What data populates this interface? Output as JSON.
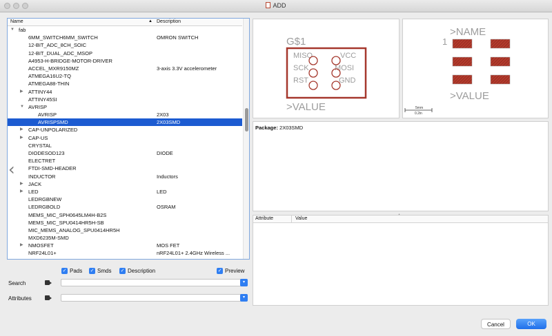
{
  "window": {
    "title": "ADD"
  },
  "tree": {
    "columns": {
      "name": "Name",
      "description": "Description"
    },
    "rows": [
      {
        "name": "fab",
        "desc": "",
        "level": 0,
        "arrow": "open"
      },
      {
        "name": "6MM_SWITCH6MM_SWITCH",
        "desc": "OMRON SWITCH",
        "level": 1,
        "arrow": ""
      },
      {
        "name": "12-BIT_ADC_8CH_SOIC",
        "desc": "",
        "level": 1,
        "arrow": ""
      },
      {
        "name": "12-BIT_DUAL_ADC_MSOP",
        "desc": "",
        "level": 1,
        "arrow": ""
      },
      {
        "name": "A4953-H-BRIDGE-MOTOR-DRIVER",
        "desc": "",
        "level": 1,
        "arrow": ""
      },
      {
        "name": "ACCEL_MXR9150MZ",
        "desc": "3-axis 3.3V accelerometer",
        "level": 1,
        "arrow": ""
      },
      {
        "name": "ATMEGA16U2-TQ",
        "desc": "",
        "level": 1,
        "arrow": ""
      },
      {
        "name": "ATMEGA88-THIN",
        "desc": "",
        "level": 1,
        "arrow": ""
      },
      {
        "name": "ATTINY44",
        "desc": "",
        "level": 1,
        "arrow": "closed"
      },
      {
        "name": "ATTINY45SI",
        "desc": "",
        "level": 1,
        "arrow": ""
      },
      {
        "name": "AVRISP",
        "desc": "",
        "level": 1,
        "arrow": "open"
      },
      {
        "name": "AVRISP",
        "desc": "2X03",
        "level": 2,
        "arrow": ""
      },
      {
        "name": "AVRISPSMD",
        "desc": "2X03SMD",
        "level": 2,
        "arrow": "",
        "selected": true
      },
      {
        "name": "CAP-UNPOLARIZED",
        "desc": "",
        "level": 1,
        "arrow": "closed"
      },
      {
        "name": "CAP-US",
        "desc": "",
        "level": 1,
        "arrow": "closed"
      },
      {
        "name": "CRYSTAL",
        "desc": "",
        "level": 1,
        "arrow": ""
      },
      {
        "name": "DIODESOD123",
        "desc": "DIODE",
        "level": 1,
        "arrow": ""
      },
      {
        "name": "ELECTRET",
        "desc": "",
        "level": 1,
        "arrow": ""
      },
      {
        "name": "FTDI-SMD-HEADER",
        "desc": "",
        "level": 1,
        "arrow": ""
      },
      {
        "name": "INDUCTOR",
        "desc": "Inductors",
        "level": 1,
        "arrow": ""
      },
      {
        "name": "JACK",
        "desc": "",
        "level": 1,
        "arrow": "closed"
      },
      {
        "name": "LED",
        "desc": "LED",
        "level": 1,
        "arrow": "closed"
      },
      {
        "name": "LEDRGBNEW",
        "desc": "",
        "level": 1,
        "arrow": ""
      },
      {
        "name": "LEDRGBOLD",
        "desc": "OSRAM",
        "level": 1,
        "arrow": ""
      },
      {
        "name": "MEMS_MIC_SPH0645LM4H-B2S",
        "desc": "",
        "level": 1,
        "arrow": ""
      },
      {
        "name": "MEMS_MIC_SPU0414HR5H-SB",
        "desc": "",
        "level": 1,
        "arrow": ""
      },
      {
        "name": "MIC_MEMS_ANALOG_SPU0414HR5H",
        "desc": "",
        "level": 1,
        "arrow": ""
      },
      {
        "name": "MXD6235M-SMD",
        "desc": "",
        "level": 1,
        "arrow": ""
      },
      {
        "name": "NMOSFET",
        "desc": "MOS FET",
        "level": 1,
        "arrow": "closed"
      },
      {
        "name": "NRF24L01+",
        "desc": "nRF24L01+ 2.4GHz Wireless ...",
        "level": 1,
        "arrow": ""
      }
    ]
  },
  "filters": {
    "pads": "Pads",
    "smds": "Smds",
    "description": "Description",
    "preview": "Preview"
  },
  "search": {
    "label": "Search",
    "value": "",
    "placeholder": ""
  },
  "attributes": {
    "label": "Attributes",
    "value": "",
    "placeholder": ""
  },
  "symbol": {
    "name_label": "G$1",
    "value_label": ">VALUE",
    "pins_left": [
      "MISO",
      "SCK",
      "RST"
    ],
    "pins_right": [
      "VCC",
      "MOSI",
      "GND"
    ]
  },
  "footprint": {
    "name_label": ">NAME",
    "value_label": ">VALUE",
    "pin1": "1",
    "scale_top": "5mm",
    "scale_bottom": "0.2in"
  },
  "package": {
    "label": "Package:",
    "value": "2X03SMD"
  },
  "attr_table": {
    "col_attribute": "Attribute",
    "col_value": "Value"
  },
  "buttons": {
    "cancel": "Cancel",
    "ok": "OK"
  },
  "colors": {
    "accent": "#2f7ef2",
    "selection": "#1c5bd1",
    "schematic_red": "#a5372c",
    "schematic_grey": "#9c9c9c",
    "pad_fill": "#b33a2c"
  }
}
